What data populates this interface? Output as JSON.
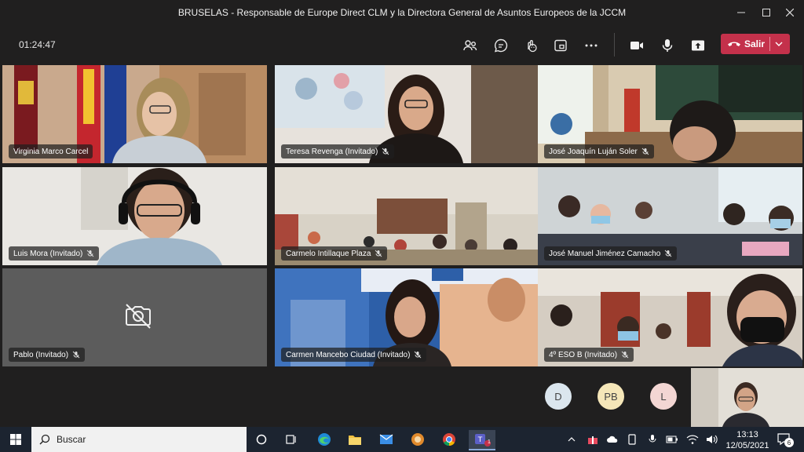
{
  "window": {
    "title": "BRUSELAS - Responsable de Europe Direct CLM y la Directora General de Asuntos Europeos de la JCCM"
  },
  "toolbar": {
    "timer": "01:24:47",
    "leave_label": "Salir",
    "icons": [
      "participants-icon",
      "chat-icon",
      "reactions-icon",
      "rooms-icon",
      "more-icon",
      "camera-icon",
      "mic-icon",
      "share-icon"
    ]
  },
  "participants": [
    {
      "name": "Virginia Marco Carcel",
      "muted": false
    },
    {
      "name": "Teresa Revenga (Invitado)",
      "muted": true
    },
    {
      "name": "José Joaquín Luján Soler",
      "muted": true
    },
    {
      "name": "Luis Mora (Invitado)",
      "muted": true
    },
    {
      "name": "Carmelo Intillaque Plaza",
      "muted": true
    },
    {
      "name": "José Manuel Jiménez Camacho",
      "muted": true
    },
    {
      "name": "Pablo (Invitado)",
      "muted": true
    },
    {
      "name": "Carmen Mancebo Ciudad (Invitado)",
      "muted": true
    },
    {
      "name": "4º ESO B (Invitado)",
      "muted": true
    }
  ],
  "overflow_avatars": [
    {
      "initials": "D",
      "color": "#dbe6ee"
    },
    {
      "initials": "PB",
      "color": "#f5e6b8"
    },
    {
      "initials": "L",
      "color": "#f3d6d3"
    }
  ],
  "taskbar": {
    "search_placeholder": "Buscar",
    "time": "13:13",
    "date": "12/05/2021",
    "notification_count": "6",
    "teams_badge": "1"
  }
}
